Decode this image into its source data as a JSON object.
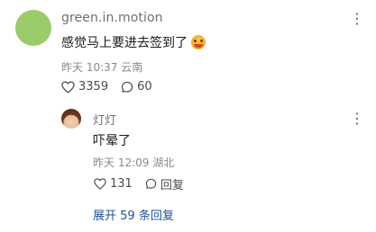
{
  "main_comment": {
    "username": "green.in.motion",
    "text": "感觉马上要进去签到了",
    "emoji": "emoji-face-icon",
    "time": "昨天 10:37",
    "location": "云南",
    "likes": "3359",
    "comments": "60"
  },
  "reply": {
    "username": "灯灯",
    "text": "吓晕了",
    "time": "昨天 12:09",
    "location": "湖北",
    "likes": "131",
    "reply_label": "回复"
  },
  "expand": {
    "prefix": "展开",
    "count": "59",
    "suffix": "条回复"
  },
  "colors": {
    "avatar_main": "#9ccb6b",
    "link": "#1f4f9a",
    "meta": "#8a8a8a"
  }
}
